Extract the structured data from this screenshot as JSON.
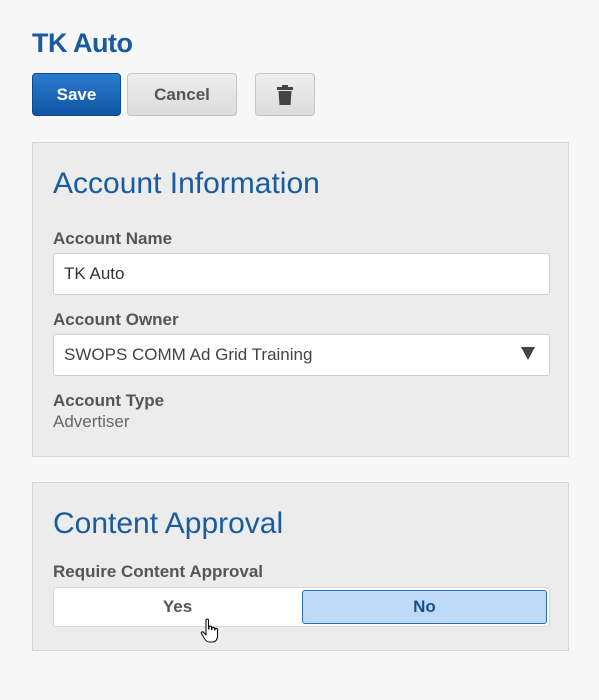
{
  "header": {
    "title": "TK Auto"
  },
  "toolbar": {
    "save_label": "Save",
    "cancel_label": "Cancel",
    "delete_icon": "trash-icon"
  },
  "account_info": {
    "title": "Account Information",
    "account_name": {
      "label": "Account Name",
      "value": "TK Auto"
    },
    "account_owner": {
      "label": "Account Owner",
      "selected": "SWOPS COMM Ad Grid Training"
    },
    "account_type": {
      "label": "Account Type",
      "value": "Advertiser"
    }
  },
  "content_approval": {
    "title": "Content Approval",
    "require_label": "Require Content Approval",
    "options": [
      "Yes",
      "No"
    ],
    "selected": "No"
  },
  "colors": {
    "accent": "#1a5a9e",
    "primary_button": "#1d63b5",
    "selected_toggle": "#bddbf8"
  }
}
